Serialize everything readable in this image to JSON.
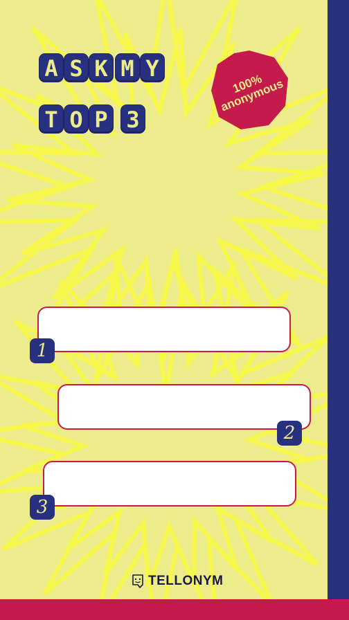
{
  "title": {
    "row1": [
      "A",
      "S",
      "K",
      "M",
      "Y"
    ],
    "row2": [
      "T",
      "O",
      "P",
      "3"
    ]
  },
  "badge": {
    "line1": "100%",
    "line2": "anonymous"
  },
  "answers": [
    {
      "number": "1",
      "value": ""
    },
    {
      "number": "2",
      "value": ""
    },
    {
      "number": "3",
      "value": ""
    }
  ],
  "footer": {
    "brand": "TELLONYM",
    "icon": "tellonym-face-icon"
  },
  "colors": {
    "background": "#ecec8c",
    "burst": "#f4f43a",
    "navy": "#283180",
    "crimson": "#c41a4c"
  }
}
